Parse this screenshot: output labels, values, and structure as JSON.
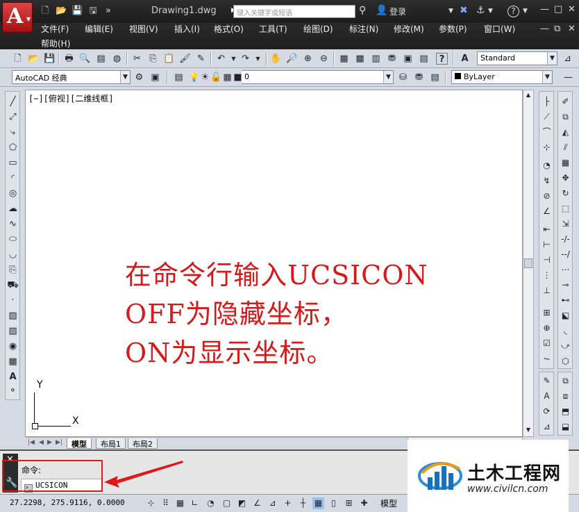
{
  "titlebar": {
    "doc_title": "Drawing1.dwg",
    "search_placeholder": "键入关键字或短语",
    "login_label": "登录",
    "overflow": "»",
    "help": "?"
  },
  "menu": {
    "items": [
      "文件(F)",
      "编辑(E)",
      "视图(V)",
      "插入(I)",
      "格式(O)",
      "工具(T)",
      "绘图(D)",
      "标注(N)",
      "修改(M)",
      "参数(P)",
      "窗口(W)",
      "帮助(H)"
    ]
  },
  "toolbar": {
    "text_style": "Standard",
    "workspace": "AutoCAD 经典",
    "layer": "0",
    "color": "ByLayer"
  },
  "viewport": {
    "label": "[−][俯视][二维线框]",
    "annotation_lines": [
      "在命令行输入UCSICON",
      "OFF为隐藏坐标，",
      "ON为显示坐标。"
    ],
    "ucs_y": "Y",
    "ucs_x": "X"
  },
  "tabs": [
    "模型",
    "布局1",
    "布局2"
  ],
  "command": {
    "prompt": "命令:",
    "input": "UCSICON"
  },
  "status": {
    "coordinates": "27.2298,  275.9116,  0.0000",
    "model_label": "模型"
  },
  "watermark": {
    "title": "土木工程网",
    "url": "www.civilcn.com"
  },
  "colors": {
    "annotation": "#d41a1a",
    "highlight_box": "#e01818",
    "app_button": "#c01818"
  }
}
